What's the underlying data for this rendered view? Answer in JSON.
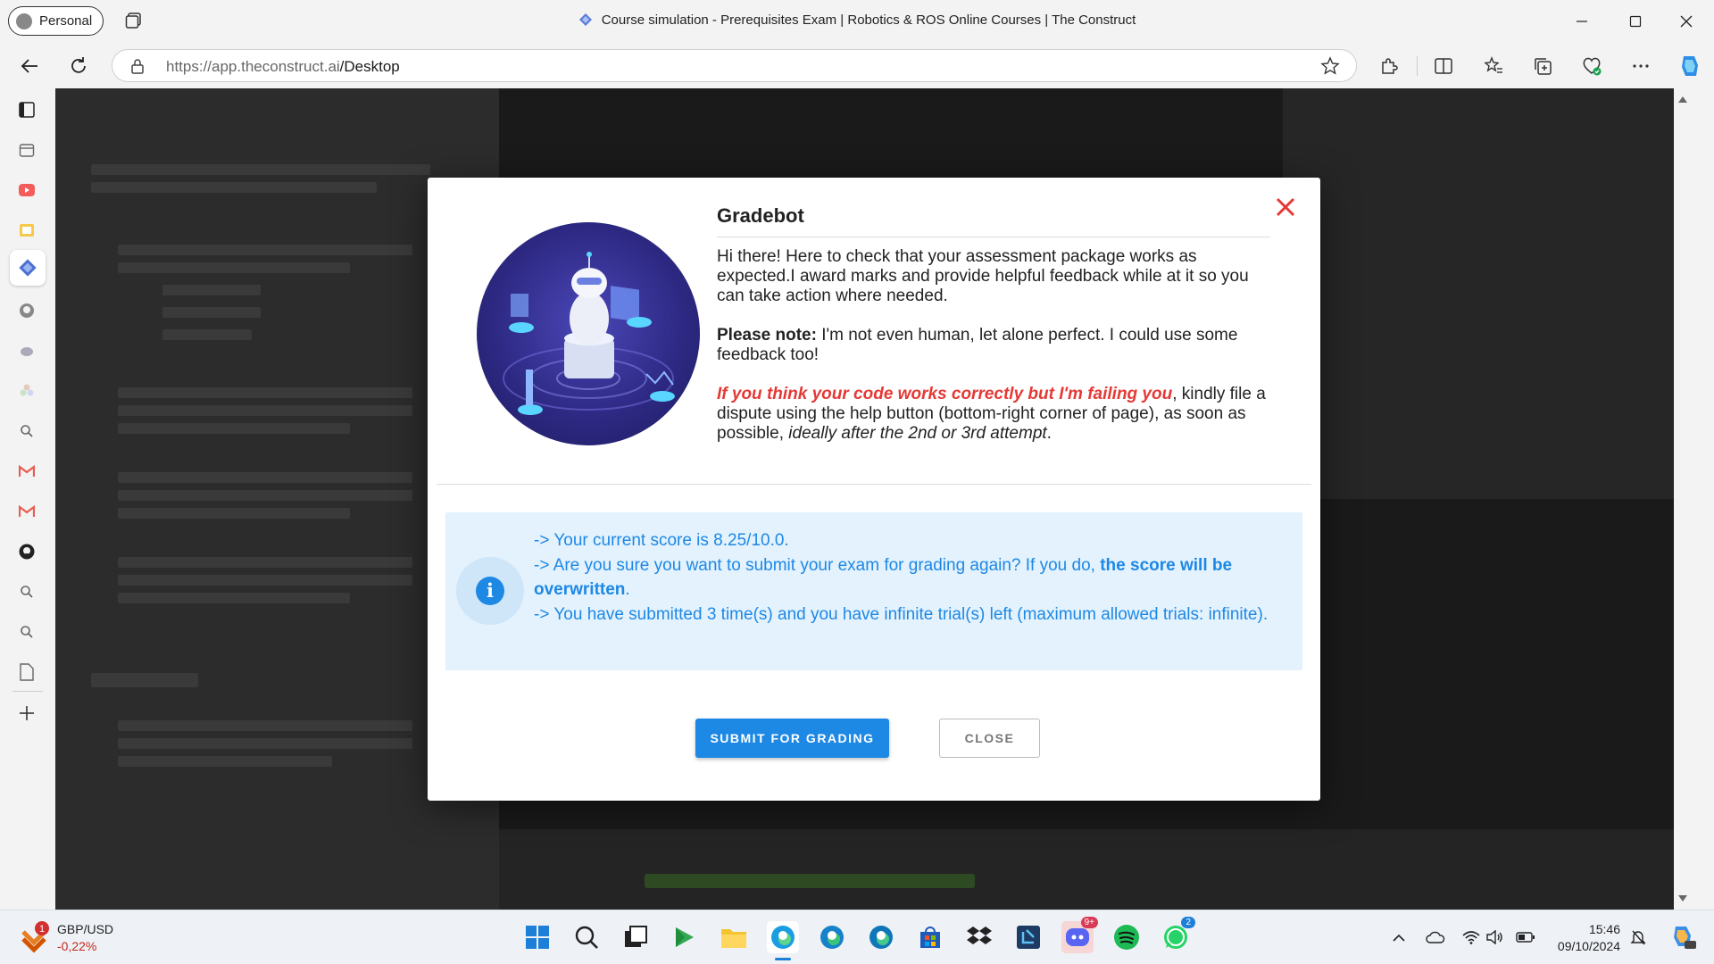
{
  "browser": {
    "profile_label": "Personal",
    "window_title": "Course simulation - Prerequisites Exam | Robotics & ROS Online Courses | The Construct",
    "url_host": "https://app.theconstruct.ai",
    "url_path": "/Desktop"
  },
  "modal": {
    "title": "Gradebot",
    "intro": "Hi there! Here to check that your assessment package works as expected.I award marks and provide helpful feedback while at it so you can take action where needed.",
    "note_label": "Please note:",
    "note_text": " I'm not even human, let alone perfect. I could use some feedback too!",
    "dispute_red": "If you think your code works correctly but I'm failing you",
    "dispute_text": ", kindly file a dispute using the help button (bottom-right corner of page), as soon as possible, ",
    "dispute_italic": "ideally after the 2nd or 3rd attempt",
    "dispute_end": ".",
    "info": {
      "line1": "-> Your current score is 8.25/10.0.",
      "line2_pre": "->  Are you sure you want to submit your exam for grading again? If you do, ",
      "line2_bold": "the score will be overwritten",
      "line2_end": ".",
      "line3": "-> You have submitted 3 time(s) and you have infinite trial(s) left (maximum allowed trials: infinite)."
    },
    "submit_label": "SUBMIT FOR GRADING",
    "close_label": "CLOSE"
  },
  "taskbar": {
    "widget_badge": "1",
    "ticker": "GBP/USD",
    "change": "-0,22%",
    "discord_badge": "9+",
    "whatsapp_badge": "2",
    "time": "15:46",
    "date": "09/10/2024"
  },
  "colors": {
    "accent": "#1e88e5",
    "info_bg": "#e3f2fd",
    "danger": "#e53935"
  }
}
